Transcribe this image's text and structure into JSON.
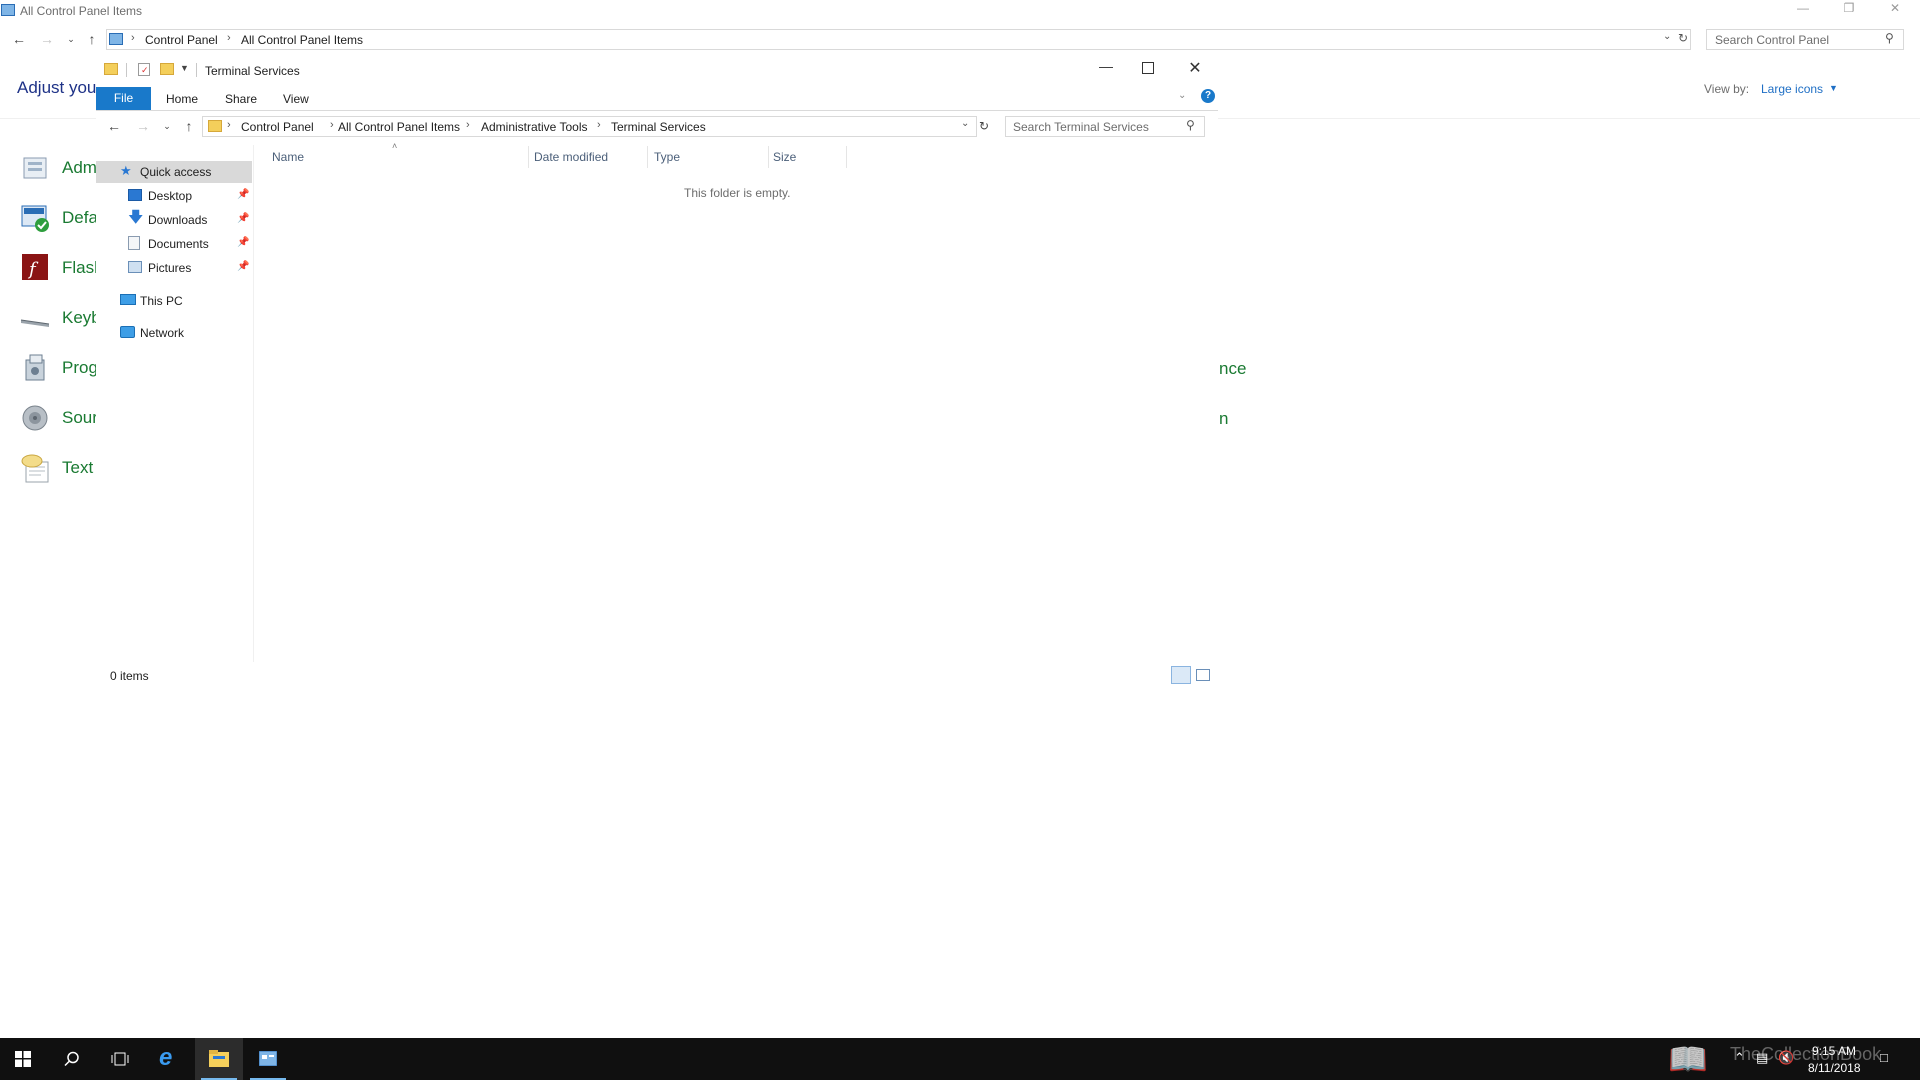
{
  "cp_window": {
    "title": "All Control Panel Items",
    "breadcrumb": [
      "Control Panel",
      "All Control Panel Items"
    ],
    "search_placeholder": "Search Control Panel",
    "heading": "Adjust your",
    "view_by_label": "View by:",
    "view_by_value": "Large icons",
    "items": [
      {
        "label": "Adm",
        "icon": "administrative-tools-icon"
      },
      {
        "label": "Defa",
        "icon": "default-programs-icon"
      },
      {
        "label": "Flash",
        "icon": "flash-player-icon"
      },
      {
        "label": "Keyb",
        "icon": "keyboard-icon"
      },
      {
        "label": "Prog",
        "icon": "programs-features-icon"
      },
      {
        "label": "Sour",
        "icon": "sound-icon"
      },
      {
        "label": "Text t",
        "icon": "text-to-speech-icon"
      }
    ],
    "peek_right": [
      "nce",
      "n"
    ]
  },
  "explorer": {
    "title": "Terminal Services",
    "ribbon_tabs": [
      "File",
      "Home",
      "Share",
      "View"
    ],
    "breadcrumb": [
      "Control Panel",
      "All Control Panel Items",
      "Administrative Tools",
      "Terminal Services"
    ],
    "search_placeholder": "Search Terminal Services",
    "nav": {
      "quick_access": "Quick access",
      "pinned": [
        {
          "label": "Desktop",
          "icon": "desktop-icon"
        },
        {
          "label": "Downloads",
          "icon": "downloads-icon"
        },
        {
          "label": "Documents",
          "icon": "documents-icon"
        },
        {
          "label": "Pictures",
          "icon": "pictures-icon"
        }
      ],
      "this_pc": "This PC",
      "network": "Network"
    },
    "columns": [
      "Name",
      "Date modified",
      "Type",
      "Size"
    ],
    "empty_message": "This folder is empty.",
    "status": "0 items"
  },
  "taskbar": {
    "time": "9:15 AM",
    "date": "8/11/2018",
    "watermark": "TheCollectionBook"
  },
  "colors": {
    "accent": "#1979ca",
    "link": "#1f6fc5",
    "cp_item_label": "#1a7a32",
    "taskbar": "#101010"
  }
}
